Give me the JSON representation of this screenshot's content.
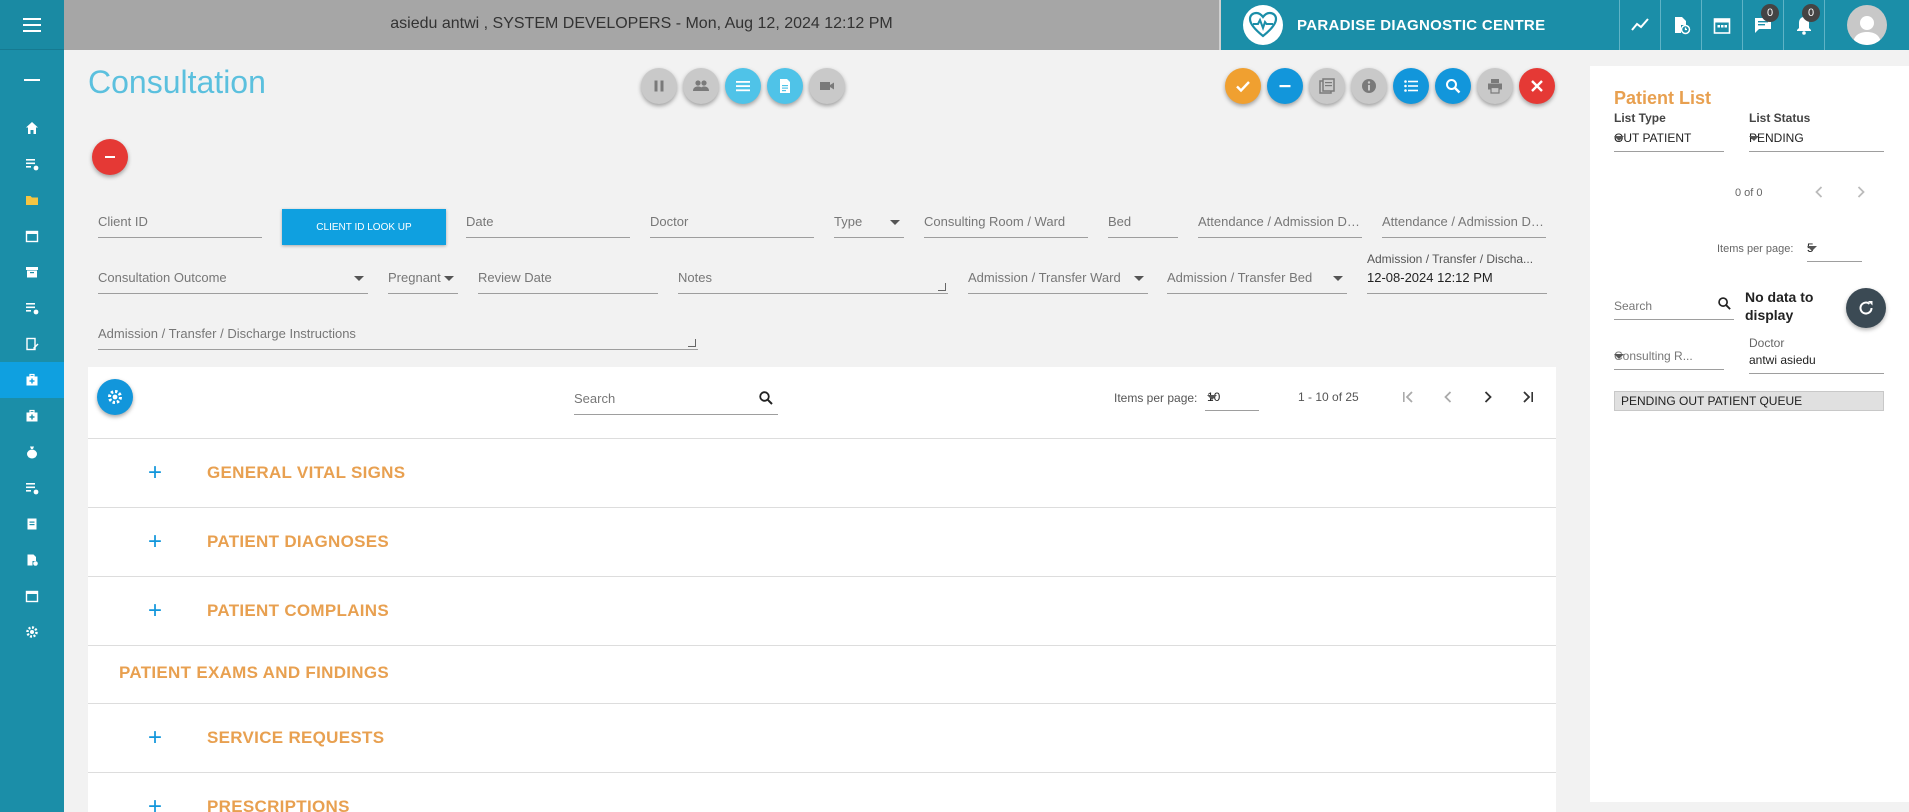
{
  "topbar": {
    "user_info": "asiedu antwi , SYSTEM DEVELOPERS - Mon, Aug 12, 2024 12:12 PM",
    "brand_name": "PARADISE DIAGNOSTIC CENTRE",
    "chat_badge": "0",
    "notification_badge": "0"
  },
  "page": {
    "title": "Consultation"
  },
  "form": {
    "client_id": "Client ID",
    "lookup_button": "CLIENT ID LOOK UP",
    "date": "Date",
    "doctor": "Doctor",
    "type": "Type",
    "consulting_room": "Consulting Room / Ward",
    "bed": "Bed",
    "attendance_date": "Attendance / Admission Date",
    "attendance_duration": "Attendance / Admission Du...",
    "consultation_outcome": "Consultation Outcome",
    "pregnant": "Pregnant",
    "review_date": "Review Date",
    "notes": "Notes",
    "transfer_ward": "Admission / Transfer Ward",
    "transfer_bed": "Admission / Transfer Bed",
    "discharge_label": "Admission / Transfer / Discha...",
    "discharge_value": "12-08-2024 12:12 PM",
    "instructions": "Admission / Transfer / Discharge Instructions"
  },
  "table": {
    "search_placeholder": "Search",
    "items_per_page_label": "Items per page:",
    "items_per_page": "10",
    "range": "1 - 10 of 25",
    "sections": [
      {
        "title": "GENERAL VITAL SIGNS"
      },
      {
        "title": "PATIENT DIAGNOSES"
      },
      {
        "title": "PATIENT COMPLAINS"
      },
      {
        "title": "PATIENT EXAMS AND FINDINGS"
      },
      {
        "title": "SERVICE REQUESTS"
      },
      {
        "title": "PRESCRIPTIONS"
      }
    ]
  },
  "patient_list": {
    "title": "Patient List",
    "list_type_label": "List Type",
    "list_type_value": "OUT PATIENT",
    "list_status_label": "List Status",
    "list_status_value": "PENDING",
    "range": "0 of 0",
    "items_per_page_label": "Items per page:",
    "items_per_page": "5",
    "search_placeholder": "Search",
    "no_data": "No data to display",
    "consulting_room": "Consulting R...",
    "doctor_label": "Doctor",
    "doctor_value": "antwi  asiedu",
    "queue_label": "PENDING OUT PATIENT QUEUE"
  },
  "colors": {
    "sidebar": "#1b8ea8",
    "accent_blue": "#1296db",
    "title_blue": "#5bc0de",
    "section_orange": "#e8a050"
  }
}
